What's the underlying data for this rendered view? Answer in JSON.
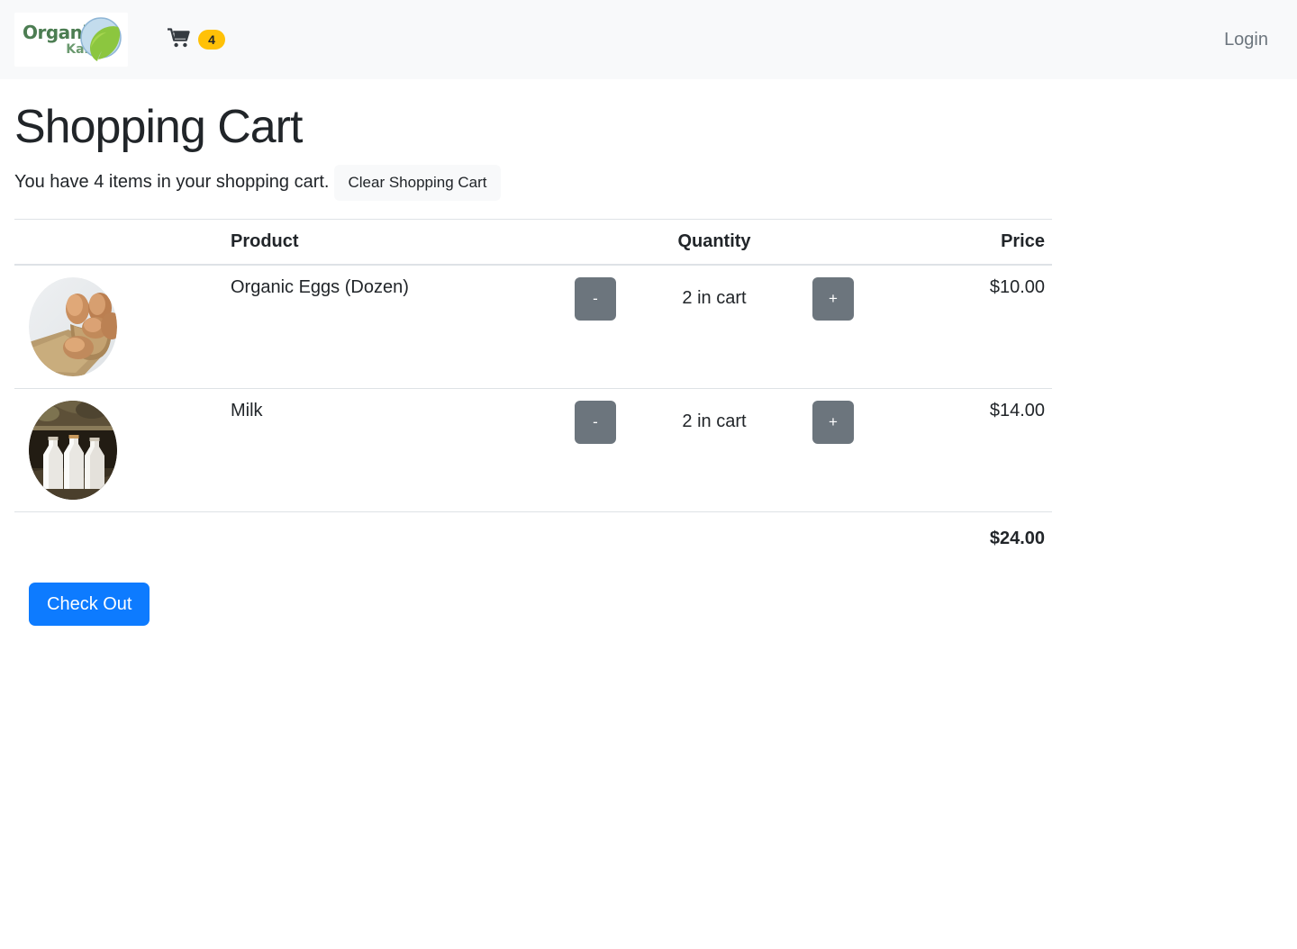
{
  "header": {
    "brand": {
      "name_top": "Organic",
      "name_bottom": "Kart",
      "icon": "leaf-logo-icon",
      "colors": {
        "text_top": "#4c7d52",
        "text_bottom": "#6b9a6f",
        "leaf": "#8cc63f",
        "circle": "#b9d7ea"
      }
    },
    "cart": {
      "icon": "shopping-cart-icon",
      "badge_count": "4",
      "badge_color": "#ffc107"
    },
    "login_label": "Login",
    "background": "#f8f9fa"
  },
  "main": {
    "title": "Shopping Cart",
    "summary_text": "You have 4 items in your shopping cart.",
    "clear_button_label": "Clear Shopping Cart",
    "checkout_button_label": "Check Out",
    "checkout_color": "#0d7bff",
    "table": {
      "columns": [
        "",
        "Product",
        "Quantity",
        "Price"
      ],
      "rows": [
        {
          "image": "organic-eggs-thumbnail",
          "product": "Organic Eggs (Dozen)",
          "decrement_label": "-",
          "quantity_label": "2 in cart",
          "increment_label": "+",
          "price": "$10.00"
        },
        {
          "image": "milk-bottles-thumbnail",
          "product": "Milk",
          "decrement_label": "-",
          "quantity_label": "2 in cart",
          "increment_label": "+",
          "price": "$14.00"
        }
      ],
      "total": "$24.00"
    }
  }
}
